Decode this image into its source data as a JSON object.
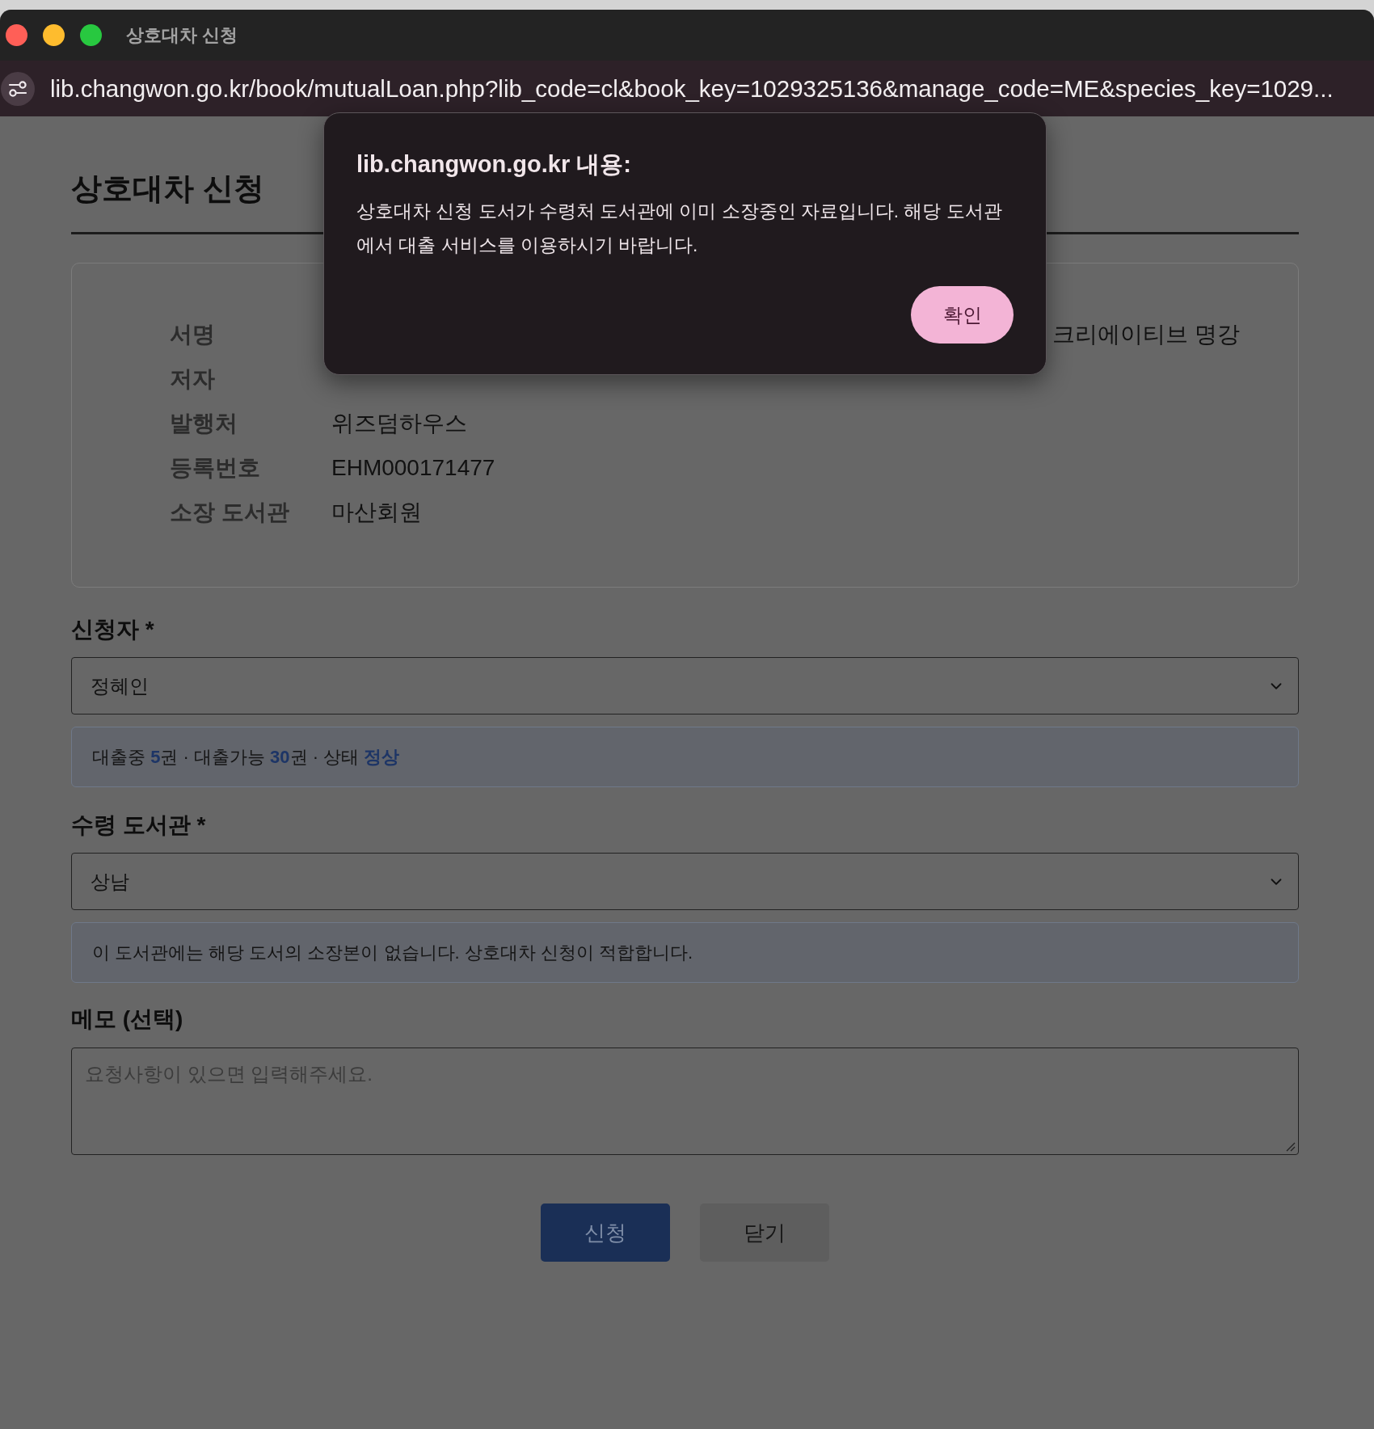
{
  "window": {
    "title": "상호대차 신청"
  },
  "address_bar": {
    "url": "lib.changwon.go.kr/book/mutualLoan.php?lib_code=cl&book_key=1029325136&manage_code=ME&species_key=1029..."
  },
  "page": {
    "heading": "상호대차 신청",
    "book_info": [
      {
        "label": "서명",
        "value_tail": "크리에이티브 명강"
      },
      {
        "label": "저자"
      },
      {
        "label": "발행처",
        "value": "위즈덤하우스"
      },
      {
        "label": "등록번호",
        "value": "EHM000171477"
      },
      {
        "label": "소장 도서관",
        "value": "마산회원"
      }
    ],
    "applicant": {
      "label": "신청자 *",
      "value": "정혜인",
      "status": "대출중 **5**권 · 대출가능 **30**권 · 상태 **정상**"
    },
    "pickup_library": {
      "label": "수령 도서관 *",
      "value": "상남",
      "notice": "이 도서관에는 해당 도서의 소장본이 없습니다. 상호대차 신청이 적합합니다."
    },
    "memo": {
      "label": "메모 (선택)",
      "placeholder": "요청사항이 있으면 입력해주세요."
    },
    "buttons": [
      {
        "label": "신청",
        "kind": "primary"
      },
      {
        "label": "닫기",
        "kind": "secondary"
      }
    ]
  },
  "dialog": {
    "title": "lib.changwon.go.kr 내용:",
    "message": "상호대차 신청 도서가 수령처 도서관에 이미 소장중인 자료입니다. 해당 도서관에서 대출 서비스를 이용하시기 바랍니다.",
    "button": "확인"
  }
}
